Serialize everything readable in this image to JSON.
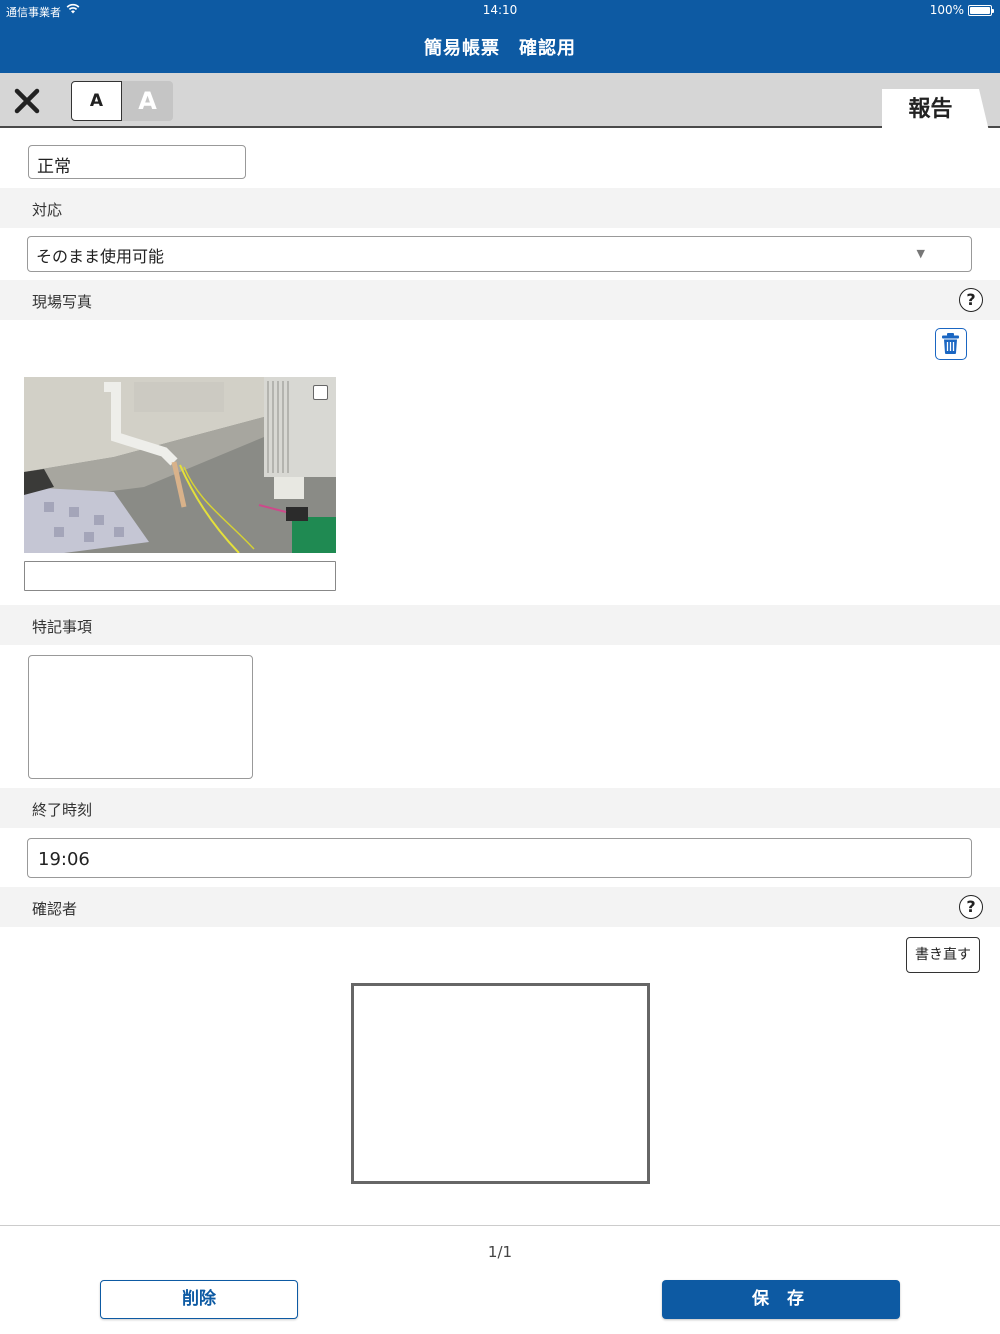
{
  "status_bar": {
    "carrier": "通信事業者",
    "time": "14:10",
    "battery": "100%",
    "battery_level": 1.0
  },
  "header": {
    "title": "簡易帳票　確認用"
  },
  "toolbar": {
    "close_icon": "close-icon",
    "font_small_label": "A",
    "font_large_label": "A",
    "report_tab_label": "報告"
  },
  "form": {
    "status_value": "正常",
    "action": {
      "label": "対応",
      "selected": "そのまま使用可能"
    },
    "photo": {
      "label": "現場写真",
      "help_icon": "help-icon",
      "trash_icon": "trash-icon",
      "caption": ""
    },
    "notes": {
      "label": "特記事項",
      "value": ""
    },
    "end_time": {
      "label": "終了時刻",
      "value": "19:06"
    },
    "confirmer": {
      "label": "確認者",
      "help_icon": "help-icon",
      "rewrite_label": "書き直す"
    }
  },
  "footer": {
    "page_counter": "1/1",
    "delete_label": "削除",
    "save_label": "保 存"
  },
  "colors": {
    "brand": "#0d5aa3",
    "toolbar_bg": "#d6d6d6",
    "section_bg": "#f3f3f3"
  }
}
